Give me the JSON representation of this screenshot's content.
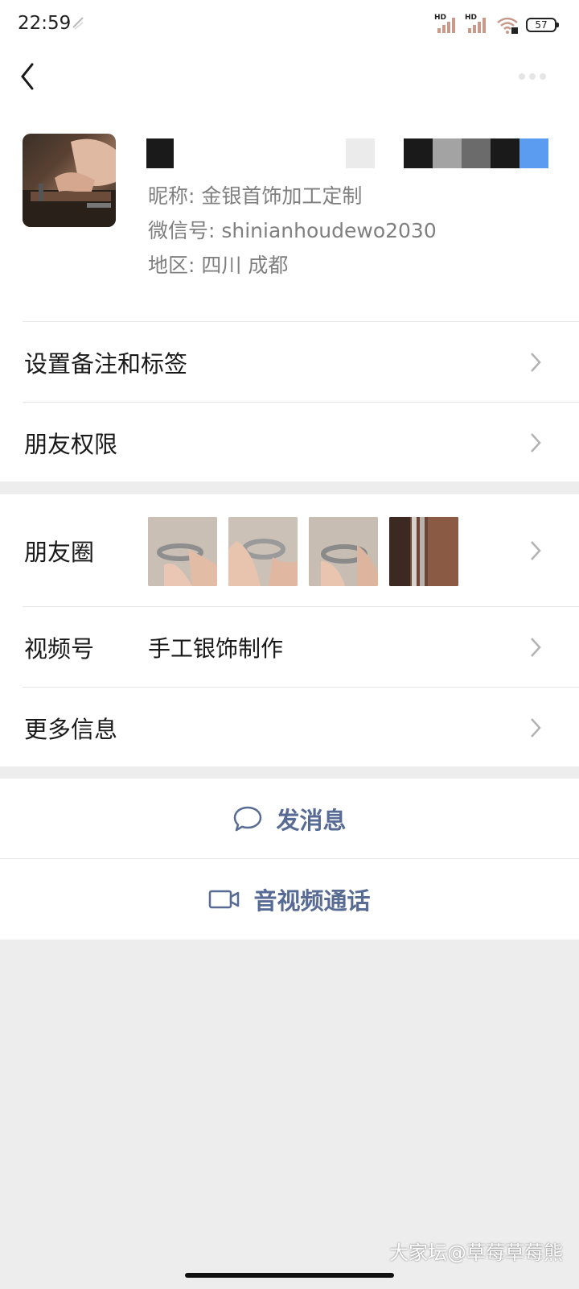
{
  "status_bar": {
    "time": "22:59",
    "signal_1": "HD",
    "signal_2": "HD",
    "battery": "57"
  },
  "profile": {
    "nickname": "昵称: 金银首饰加工定制",
    "wechat_id": "微信号: shinianhoudewo2030",
    "region": "地区: 四川  成都"
  },
  "menu": {
    "remark_tags": "设置备注和标签",
    "friend_permissions": "朋友权限",
    "moments": "朋友圈",
    "channels": "视频号",
    "channels_value": "手工银饰制作",
    "more_info": "更多信息"
  },
  "actions": {
    "send_message": "发消息",
    "video_call": "音视频通话"
  },
  "watermark": "大家坛@草莓草莓熊",
  "colors": {
    "link_blue": "#576b95",
    "background": "#ededed",
    "chevron": "#b2b2b2"
  }
}
